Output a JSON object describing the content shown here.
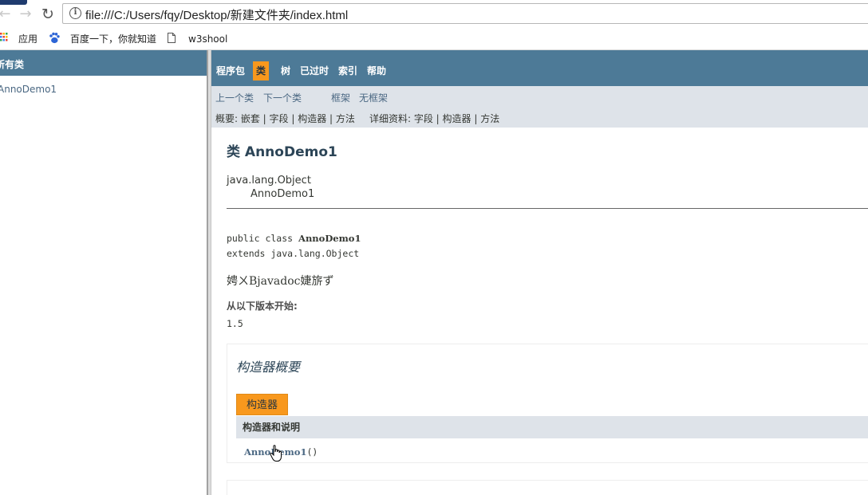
{
  "browser": {
    "url": "file:///C:/Users/fqy/Desktop/新建文件夹/index.html",
    "bookmarks": [
      {
        "label": "应用",
        "icon": "apps-grid-icon"
      },
      {
        "label": "百度一下，你就知道",
        "icon": "paw-icon"
      },
      {
        "label": "w3shool",
        "icon": "page-icon"
      }
    ]
  },
  "left_frame": {
    "header": "所有类",
    "classes": [
      "AnnoDemo1"
    ]
  },
  "top_nav": {
    "items": [
      "程序包",
      "类",
      "树",
      "已过时",
      "索引",
      "帮助"
    ],
    "active": "类"
  },
  "sub_nav": {
    "prev_class": "上一个类",
    "next_class": "下一个类",
    "frames": "框架",
    "no_frames": "无框架",
    "summary_line": "概要: 嵌套 | 字段 | 构造器 | 方法",
    "detail_line": "详细资料: 字段 | 构造器 | 方法"
  },
  "class_doc": {
    "title": "类 AnnoDemo1",
    "inheritance": [
      "java.lang.Object",
      "AnnoDemo1"
    ],
    "declaration_line1_prefix": "public class ",
    "declaration_line1_name": "AnnoDemo1",
    "declaration_line2": "extends java.lang.Object",
    "description": "娉ㄨВjavadoc婕旂ず",
    "since_label": "从以下版本开始:",
    "since_value": "1.5"
  },
  "constructor_summary": {
    "title": "构造器概要",
    "tab": "构造器",
    "column_header": "构造器和说明",
    "rows": [
      {
        "name": "AnnoDemo1",
        "params": "()"
      }
    ]
  },
  "colors": {
    "nav_bg": "#4d7a97",
    "active_tab": "#f8981d",
    "subnav_bg": "#dee3e9"
  }
}
